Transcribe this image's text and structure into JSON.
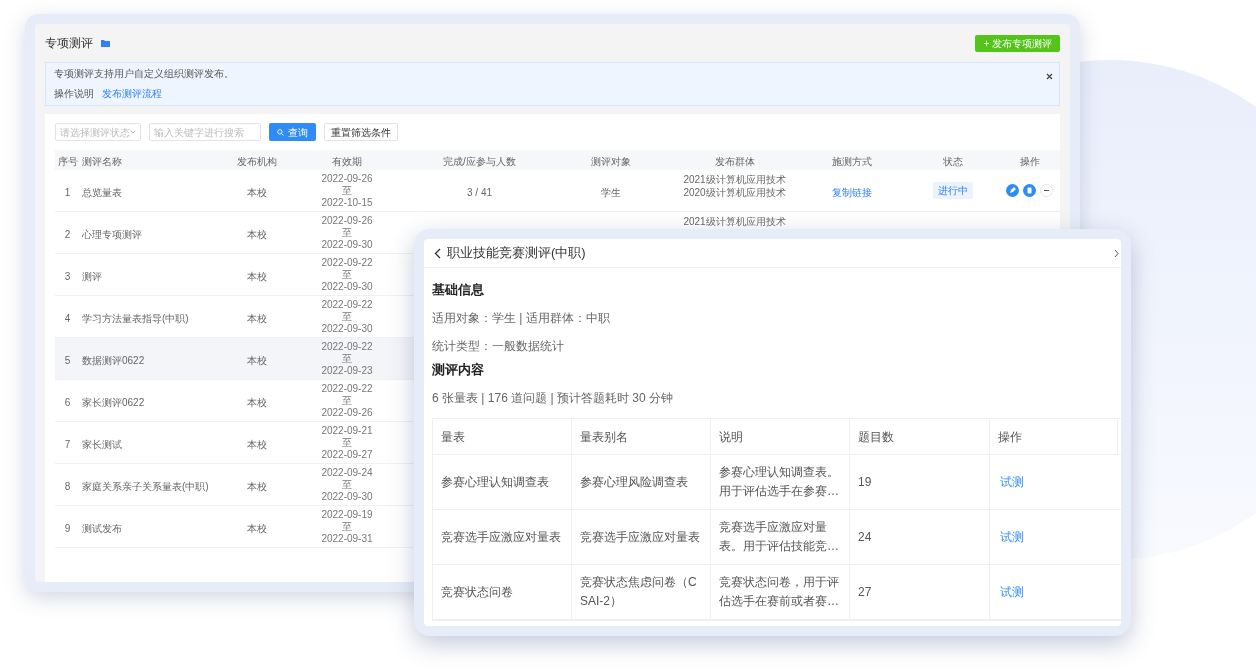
{
  "back_window": {
    "title": "专项测评",
    "publish_button": "+ 发布专项测评",
    "banner": {
      "text": "专项测评支持用户自定义组织测评发布。",
      "help_label": "操作说明",
      "help_link": "发布测评流程"
    },
    "filters": {
      "status_placeholder": "请选择测评状态",
      "keyword_placeholder": "输入关键字进行搜索",
      "search_button": "查询",
      "reset_button": "重置筛选条件"
    },
    "table": {
      "columns": [
        "序号",
        "测评名称",
        "发布机构",
        "有效期",
        "完成/应参与人数",
        "测评对象",
        "发布群体",
        "施测方式",
        "状态",
        "操作"
      ],
      "rows": [
        {
          "index": "1",
          "name": "总览量表",
          "org": "本校",
          "valid_from": "2022-09-26",
          "to_label": "至",
          "valid_to": "2022-10-15",
          "completion": "3 / 41",
          "target": "学生",
          "groups": [
            "2021级计算机应用技术",
            "2020级计算机应用技术"
          ],
          "method": "复制链接",
          "status": "进行中",
          "actions_visible": true,
          "highlighted": false
        },
        {
          "index": "2",
          "name": "心理专项测评",
          "org": "本校",
          "valid_from": "2022-09-26",
          "to_label": "至",
          "valid_to": "2022-09-30",
          "groups": [
            "2021级计算机应用技术"
          ],
          "highlighted": false
        },
        {
          "index": "3",
          "name": "测评",
          "org": "本校",
          "valid_from": "2022-09-22",
          "to_label": "至",
          "valid_to": "2022-09-30",
          "highlighted": false
        },
        {
          "index": "4",
          "name": "学习方法量表指导(中职)",
          "org": "本校",
          "valid_from": "2022-09-22",
          "to_label": "至",
          "valid_to": "2022-09-30",
          "highlighted": false
        },
        {
          "index": "5",
          "name": "数据测评0622",
          "org": "本校",
          "valid_from": "2022-09-22",
          "to_label": "至",
          "valid_to": "2022-09-23",
          "highlighted": true
        },
        {
          "index": "6",
          "name": "家长测评0622",
          "org": "本校",
          "valid_from": "2022-09-22",
          "to_label": "至",
          "valid_to": "2022-09-26",
          "highlighted": false
        },
        {
          "index": "7",
          "name": "家长测试",
          "org": "本校",
          "valid_from": "2022-09-21",
          "to_label": "至",
          "valid_to": "2022-09-27",
          "highlighted": false
        },
        {
          "index": "8",
          "name": "家庭关系亲子关系量表(中职)",
          "org": "本校",
          "valid_from": "2022-09-24",
          "to_label": "至",
          "valid_to": "2022-09-30",
          "highlighted": false
        },
        {
          "index": "9",
          "name": "测试发布",
          "org": "本校",
          "valid_from": "2022-09-19",
          "to_label": "至",
          "valid_to": "2022-09-31",
          "highlighted": false
        }
      ]
    }
  },
  "detail_panel": {
    "title": "职业技能竞赛测评(中职)",
    "sections": [
      {
        "heading": "基础信息",
        "lines": [
          "适用对象：学生 | 适用群体：中职",
          "统计类型：一般数据统计"
        ]
      },
      {
        "heading": "测评内容",
        "lines": [
          "6 张量表 | 176 道问题 | 预计答题耗时 30 分钟"
        ]
      }
    ],
    "table": {
      "columns": [
        "量表",
        "量表别名",
        "说明",
        "题目数",
        "操作"
      ],
      "rows": [
        {
          "scale": "参赛心理认知调查表",
          "alias": "参赛心理风险调查表",
          "description": "参赛心理认知调查表。用于评估选手在参赛…",
          "count": "19",
          "action": "试测"
        },
        {
          "scale": "竞赛选手应激应对量表",
          "alias": "竞赛选手应激应对量表",
          "description": "竞赛选手应激应对量表。用于评估技能竞…",
          "count": "24",
          "action": "试测"
        },
        {
          "scale": "竞赛状态问卷",
          "alias": "竞赛状态焦虑问卷（CSAI-2）",
          "description": "竞赛状态问卷，用于评估选手在赛前或者赛…",
          "count": "27",
          "action": "试测"
        }
      ]
    }
  }
}
